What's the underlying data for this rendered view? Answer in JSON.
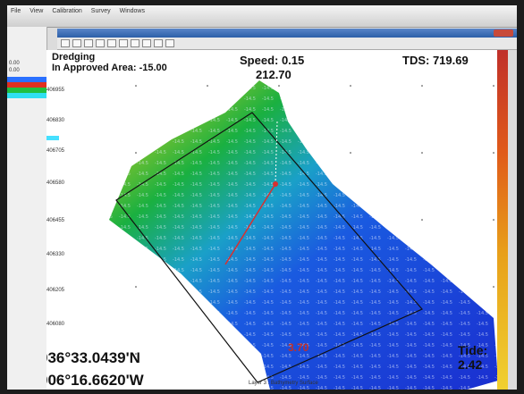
{
  "app": {
    "menu": [
      "File",
      "View",
      "Calibration",
      "Survey",
      "Windows"
    ],
    "left_values": [
      "0.00",
      "0.00"
    ]
  },
  "overlay": {
    "mode": "Dredging",
    "area_label": "In Approved Area: -15.00",
    "speed": "Speed: 0.15",
    "heading": "212.70",
    "tds": "TDS: 719.69",
    "lat": "036°33.0439'N",
    "lon": "006°16.6620'W",
    "tide": "Tide: 2.42",
    "depth": "3.70"
  },
  "grid_ticks": [
    "406955",
    "406830",
    "406705",
    "406580",
    "406455",
    "406330",
    "406205",
    "406080"
  ],
  "status": "Layer 3 : Bathymetry Surface",
  "colors": {
    "shallow": "#e08a1a",
    "mid": "#1ab040",
    "deep": "#1a2fd0",
    "track": "#d83030",
    "scale_top": "#c0302a",
    "scale_bottom": "#f0d030"
  }
}
